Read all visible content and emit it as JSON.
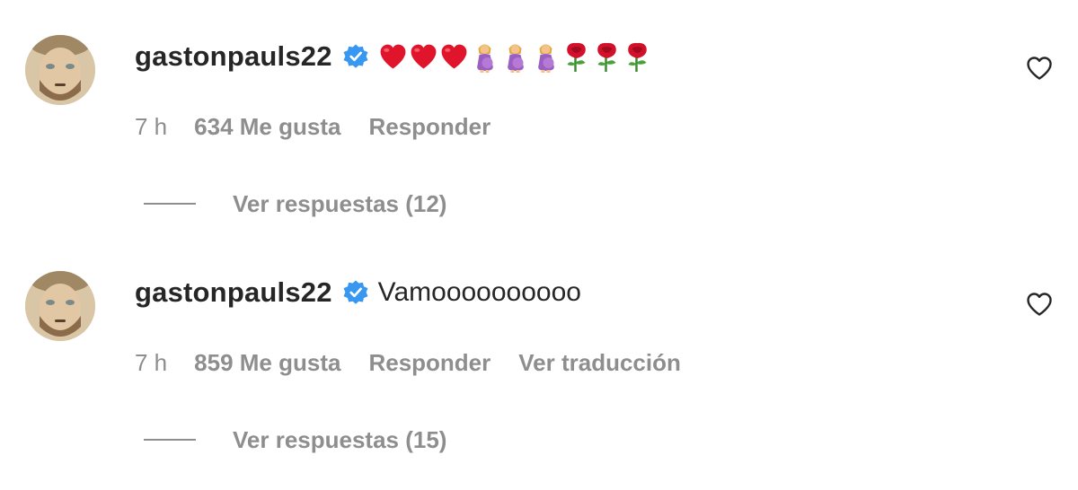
{
  "comments": [
    {
      "username": "gastonpauls22",
      "verified": true,
      "text": "",
      "emojis": [
        "red-heart",
        "red-heart",
        "red-heart",
        "pregnant-woman",
        "pregnant-woman",
        "pregnant-woman",
        "rose",
        "rose",
        "rose"
      ],
      "time": "7 h",
      "likes": "634 Me gusta",
      "reply_label": "Responder",
      "translate_label": "",
      "view_replies": "Ver respuestas (12)"
    },
    {
      "username": "gastonpauls22",
      "verified": true,
      "text": "Vamoooooooooo",
      "emojis": [],
      "time": "7 h",
      "likes": "859 Me gusta",
      "reply_label": "Responder",
      "translate_label": "Ver traducción",
      "view_replies": "Ver respuestas (15)"
    }
  ],
  "colors": {
    "primary_text": "#262626",
    "secondary_text": "#8e8e8e",
    "verified_blue": "#3897f0",
    "heart_red": "#e0142b",
    "rose_red": "#d3102a"
  },
  "icons": {
    "like": "heart-outline-icon",
    "verified": "verified-badge-icon"
  }
}
